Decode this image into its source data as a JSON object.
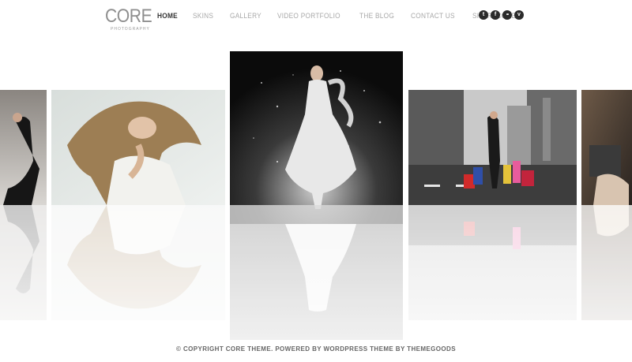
{
  "logo": {
    "main": "CORE",
    "sub": "PHOTOGRAPHY"
  },
  "nav": {
    "items": [
      "HOME",
      "SKINS",
      "GALLERY",
      "VIDEO PORTFOLIO",
      "THE BLOG",
      "CONTACT US",
      "SHORTCODES"
    ],
    "active": "HOME"
  },
  "social": [
    {
      "icon": "twitter-icon",
      "glyph": "t"
    },
    {
      "icon": "facebook-icon",
      "glyph": "f"
    },
    {
      "icon": "flickr-icon",
      "glyph": "••"
    },
    {
      "icon": "vimeo-icon",
      "glyph": "v"
    }
  ],
  "footer": {
    "text": "© COPYRIGHT CORE THEME. POWERED BY WORDPRESS THEME BY THEMEGOODS"
  },
  "colors": {
    "nav_active": "#333333",
    "nav_inactive": "#a8a8a8",
    "social_bg": "#2b2b2b"
  }
}
